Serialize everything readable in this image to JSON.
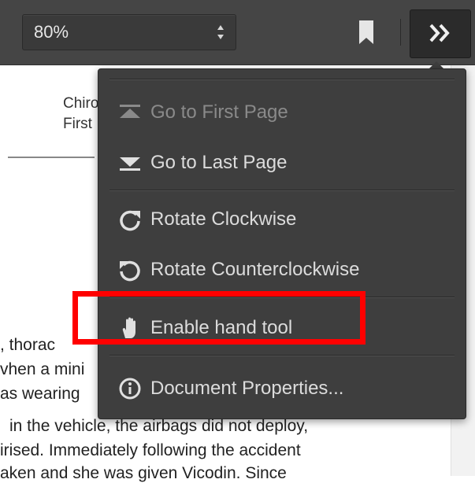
{
  "toolbar": {
    "zoom_value": "80%",
    "bookmark_icon": "bookmark-icon",
    "more_icon": "double-chevron-right-icon"
  },
  "document": {
    "heading_lines": [
      "Chiro",
      "First"
    ],
    "body_lines": [
      ", thorac",
      "vhen a mini",
      "as wearing",
      "in the vehicle, the airbags did not deploy,",
      "irised. Immediately following the accident",
      "aken and she was given Vicodin. Since"
    ]
  },
  "menu": {
    "items": [
      {
        "label": "Go to First Page",
        "icon": "first-page-icon",
        "disabled": true
      },
      {
        "label": "Go to Last Page",
        "icon": "last-page-icon",
        "disabled": false
      },
      {
        "label": "Rotate Clockwise",
        "icon": "rotate-cw-icon",
        "disabled": false
      },
      {
        "label": "Rotate Counterclockwise",
        "icon": "rotate-ccw-icon",
        "disabled": false
      },
      {
        "label": "Enable hand tool",
        "icon": "hand-icon",
        "disabled": false
      },
      {
        "label": "Document Properties...",
        "icon": "info-icon",
        "disabled": false
      }
    ]
  },
  "colors": {
    "toolbar_bg": "#454545",
    "menu_bg": "#3e3e3e",
    "highlight": "#ff0000"
  }
}
